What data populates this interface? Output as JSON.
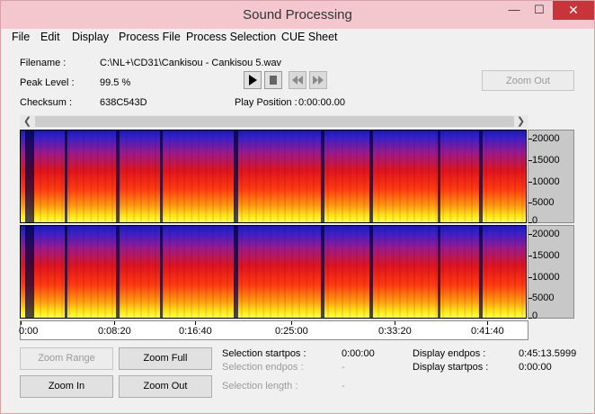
{
  "window": {
    "title": "Sound Processing",
    "min_icon": "minimize-icon",
    "max_icon": "maximize-icon",
    "close_icon": "close-icon"
  },
  "menu": [
    "File",
    "Edit",
    "Display",
    "Process File",
    "Process Selection",
    "CUE Sheet"
  ],
  "info": {
    "filename_label": "Filename :",
    "filename_value": "C:\\NL+\\CD31\\Cankisou - Cankisou 5.wav",
    "peak_label": "Peak Level :",
    "peak_value": "99.5 %",
    "checksum_label": "Checksum :",
    "checksum_value": "638C543D",
    "play_position_label": "Play Position :",
    "play_position_value": "0:00:00.00"
  },
  "transport": {
    "play_icon": "play-icon",
    "stop_icon": "stop-icon",
    "rewind_icon": "rewind-icon",
    "forward_icon": "fast-forward-icon"
  },
  "zoom_out_top": "Zoom Out",
  "spectrogram": {
    "channels": 2,
    "y_ticks": [
      "20000",
      "15000",
      "10000",
      "5000",
      "0"
    ],
    "x_ticks": [
      "0:00",
      "0:08:20",
      "0:16:40",
      "0:25:00",
      "0:33:20",
      "0:41:40"
    ]
  },
  "buttons": {
    "zoom_range": "Zoom Range",
    "zoom_full": "Zoom Full",
    "zoom_in": "Zoom In",
    "zoom_out": "Zoom Out"
  },
  "selection": {
    "startpos_label": "Selection startpos :",
    "startpos_value": "0:00:00",
    "endpos_label": "Selection endpos :",
    "endpos_value": "-",
    "length_label": "Selection length :",
    "length_value": "-"
  },
  "display": {
    "endpos_label": "Display endpos :",
    "endpos_value": "0:45:13.5999",
    "startpos_label": "Display startpos :",
    "startpos_value": "0:00:00"
  },
  "colors": {
    "titlebar": "#f3c7cd",
    "close": "#c7343a"
  }
}
